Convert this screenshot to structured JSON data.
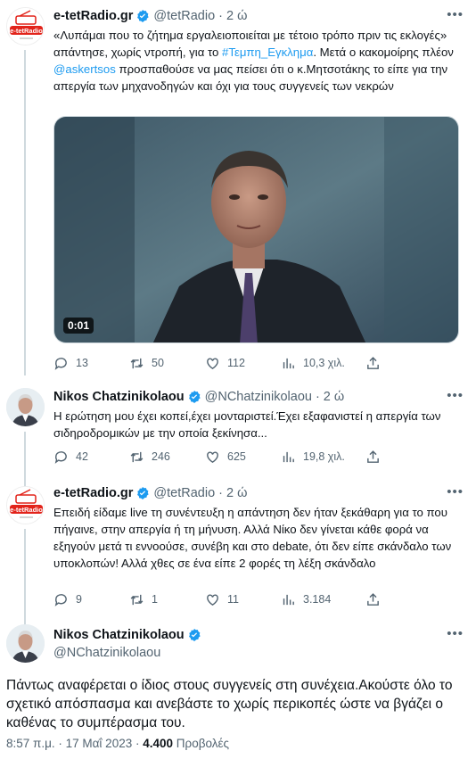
{
  "tweets": [
    {
      "name": "e-tetRadio.gr",
      "handle": "@tetRadio",
      "dot": "·",
      "time": "2 ώ",
      "avatar_label": "e-tetRadio",
      "text_parts": [
        "«Λυπάμαι που το ζήτημα εργαλειοποιείται με τέτοιο τρόπο πριν τις εκλογές» απάντησε, χωρίς ντροπή, για το ",
        "#Τεμπη_Εγκλημα",
        ". Μετά ο κακομοίρης πλέον ",
        "@askertsos",
        " προσπαθούσε να μας πείσει ότι ο κ.Μητσοτάκης το είπε για την απεργία των μηχανοδηγών και όχι για τους συγγενείς των νεκρών"
      ],
      "video_time": "0:01",
      "replies": "13",
      "retweets": "50",
      "likes": "112",
      "views": "10,3 χιλ."
    },
    {
      "name": "Nikos Chatzinikolaou",
      "handle": "@NChatzinikolaou",
      "dot": "·",
      "time": "2 ώ",
      "text": "Η ερώτηση μου έχει κοπεί,έχει μονταριστεί.Έχει εξαφανιστεί η απεργία των σιδηροδρομικών με την οποία ξεκίνησα...",
      "replies": "42",
      "retweets": "246",
      "likes": "625",
      "views": "19,8 χιλ."
    },
    {
      "name": "e-tetRadio.gr",
      "handle": "@tetRadio",
      "dot": "·",
      "time": "2 ώ",
      "avatar_label": "e-tetRadio",
      "text": "Επειδή είδαμε live τη συνέντευξη η απάντηση δεν ήταν ξεκάθαρη για το που πήγαινε, στην απεργία ή τη μήνυση. Αλλά Νίκο δεν γίνεται κάθε φορά να εξηγούν μετά τι εννοούσε, συνέβη και στο debate, ότι δεν είπε σκάνδαλο των υποκλοπών! Αλλά χθες σε ένα είπε 2 φορές τη λέξη σκάνδαλο",
      "replies": "9",
      "retweets": "1",
      "likes": "11",
      "views": "3.184"
    }
  ],
  "main_tweet": {
    "name": "Nikos Chatzinikolaou",
    "handle": "@NChatzinikolaou",
    "text": "Πάντως αναφέρεται ο ίδιος στους συγγενείς στη συνέχεια.Ακούστε όλο το σχετικό απόσπασμα και ανεβάστε το χωρίς περικοπές ώστε να βγάζει ο καθένας το συμπέρασμα του.",
    "timestamp": "8:57 π.μ. · 17 Μαΐ 2023 · ",
    "views_count": "4.400",
    "views_label": " Προβολές"
  },
  "colors": {
    "accent": "#1d9bf0",
    "muted": "#536471",
    "verified": "#1d9bf0",
    "brand_red": "#e2231a"
  }
}
